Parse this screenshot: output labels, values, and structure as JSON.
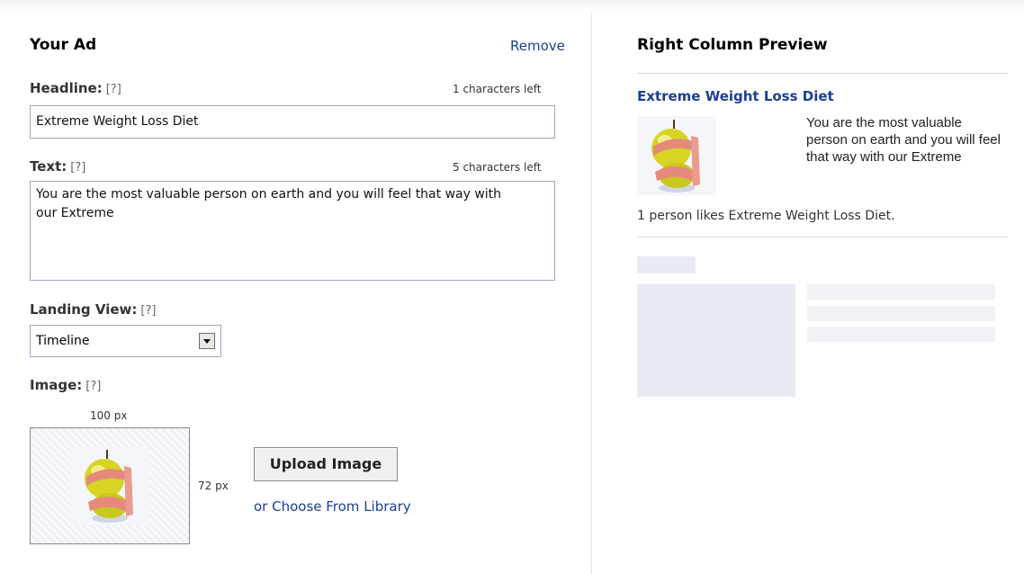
{
  "left": {
    "title": "Your Ad",
    "remove": "Remove",
    "help": "[?]",
    "headline": {
      "label": "Headline:",
      "count": "1 characters left",
      "value": "Extreme Weight Loss Diet"
    },
    "text": {
      "label": "Text:",
      "count": "5 characters left",
      "value": "You are the most valuable person on earth and you will feel that way with our Extreme"
    },
    "landing": {
      "label": "Landing View:",
      "selected": "Timeline"
    },
    "image": {
      "label": "Image:",
      "width_label": "100 px",
      "height_label": "72 px",
      "upload": "Upload Image",
      "library": "or Choose From Library"
    }
  },
  "right": {
    "title": "Right Column Preview",
    "ad_title": "Extreme Weight Loss Diet",
    "ad_body": "You are the most valuable person on earth and you will feel that way with our Extreme",
    "likes": "1 person likes Extreme Weight Loss Diet."
  }
}
